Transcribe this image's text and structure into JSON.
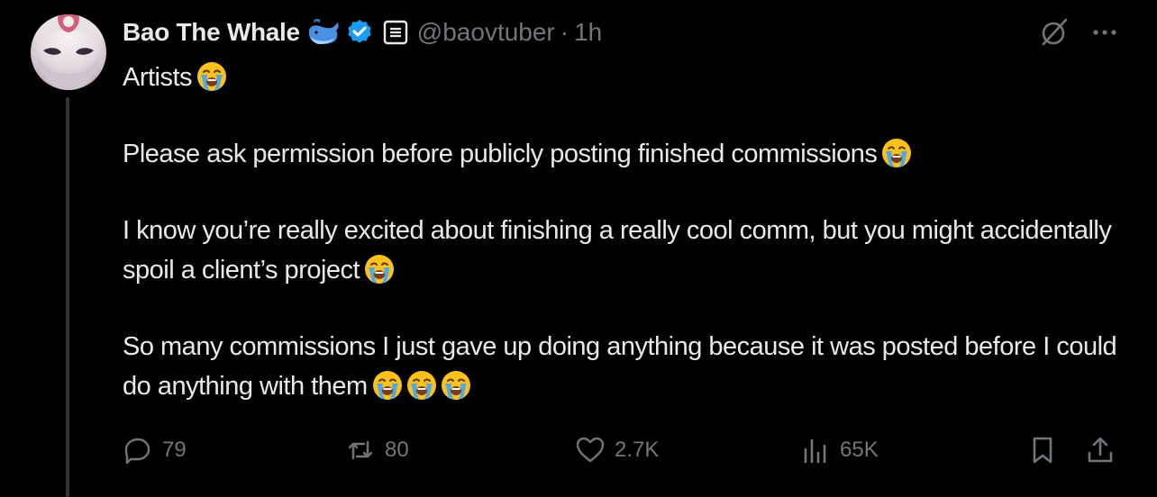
{
  "author": {
    "name": "Bao The Whale",
    "handle": "@baovtuber",
    "separator": "·",
    "time": "1h",
    "icons": [
      "whale-emoji-icon",
      "verified-badge-icon",
      "affiliate-badge-icon"
    ]
  },
  "top_icons": [
    "grok-icon",
    "more-icon"
  ],
  "tweet": {
    "paragraphs": [
      {
        "text": "Artists",
        "emoji_count": 1
      },
      {
        "text": "Please ask permission before publicly posting finished commissions",
        "emoji_count": 1
      },
      {
        "text": "I know you’re really excited about finishing a really cool comm, but you might accidentally spoil a client’s project",
        "emoji_count": 1
      },
      {
        "text": "So many commissions I just gave up doing anything because it was posted before I could do anything with them",
        "emoji_count": 3
      }
    ],
    "emoji_name": "loudly-crying-face-emoji"
  },
  "actions": {
    "replies": "79",
    "reposts": "80",
    "likes": "2.7K",
    "views": "65K"
  },
  "colors": {
    "background": "#000000",
    "text": "#e7e9ea",
    "muted": "#71767b",
    "verified": "#1d9bf0",
    "thread_line": "#333639"
  }
}
